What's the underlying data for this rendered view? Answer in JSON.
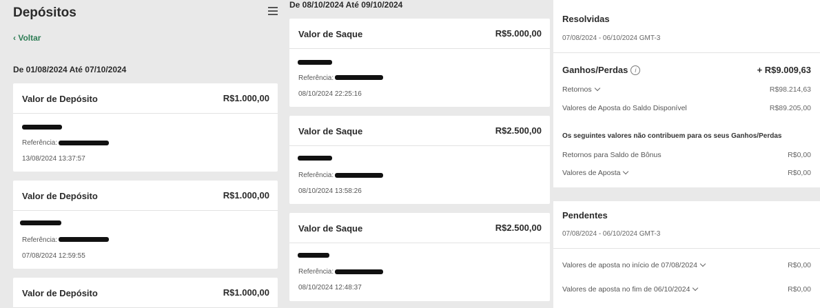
{
  "deposits": {
    "title": "Depósitos",
    "back_label": "Voltar",
    "range_label": "De 01/08/2024 Até 07/10/2024",
    "cards": [
      {
        "label": "Valor de Depósito",
        "amount": "R$1.000,00",
        "ref_label": "Referência:",
        "timestamp": "13/08/2024 13:37:57"
      },
      {
        "label": "Valor de Depósito",
        "amount": "R$1.000,00",
        "ref_label": "Referência:",
        "timestamp": "07/08/2024 12:59:55"
      },
      {
        "label": "Valor de Depósito",
        "amount": "R$1.000,00"
      }
    ]
  },
  "withdrawals": {
    "range_label": "De 08/10/2024 Até 09/10/2024",
    "cards": [
      {
        "label": "Valor de Saque",
        "amount": "R$5.000,00",
        "ref_label": "Referência:",
        "timestamp": "08/10/2024 22:25:16"
      },
      {
        "label": "Valor de Saque",
        "amount": "R$2.500,00",
        "ref_label": "Referência:",
        "timestamp": "08/10/2024 13:58:26"
      },
      {
        "label": "Valor de Saque",
        "amount": "R$2.500,00",
        "ref_label": "Referência:",
        "timestamp": "08/10/2024 12:48:37"
      }
    ]
  },
  "resolved": {
    "title": "Resolvidas",
    "date_range": "07/08/2024 - 06/10/2024 GMT-3",
    "gains_title": "Ganhos/Perdas",
    "gains_total": "+ R$9.009,63",
    "rows": [
      {
        "label": "Retornos",
        "value": "R$98.214,63"
      },
      {
        "label": "Valores de Aposta do Saldo Disponível",
        "value": "R$89.205,00"
      }
    ],
    "note": "Os seguintes valores não contribuem para os seus Ganhos/Perdas",
    "rows2": [
      {
        "label": "Retornos para Saldo de Bônus",
        "value": "R$0,00"
      },
      {
        "label": "Valores de Aposta",
        "value": "R$0,00"
      }
    ]
  },
  "pending": {
    "title": "Pendentes",
    "date_range": "07/08/2024 - 06/10/2024 GMT-3",
    "rows": [
      {
        "label": "Valores de aposta no início de 07/08/2024",
        "value": "R$0,00"
      },
      {
        "label": "Valores de aposta no fim de 06/10/2024",
        "value": "R$0,00"
      }
    ]
  },
  "icons": {
    "menu": "hamburger-icon",
    "back": "chevron-left-icon",
    "info": "info-icon",
    "expand": "chevron-down-icon"
  },
  "colors": {
    "accent": "#2e7d55",
    "background": "#e9e9e9",
    "card": "#ffffff"
  }
}
